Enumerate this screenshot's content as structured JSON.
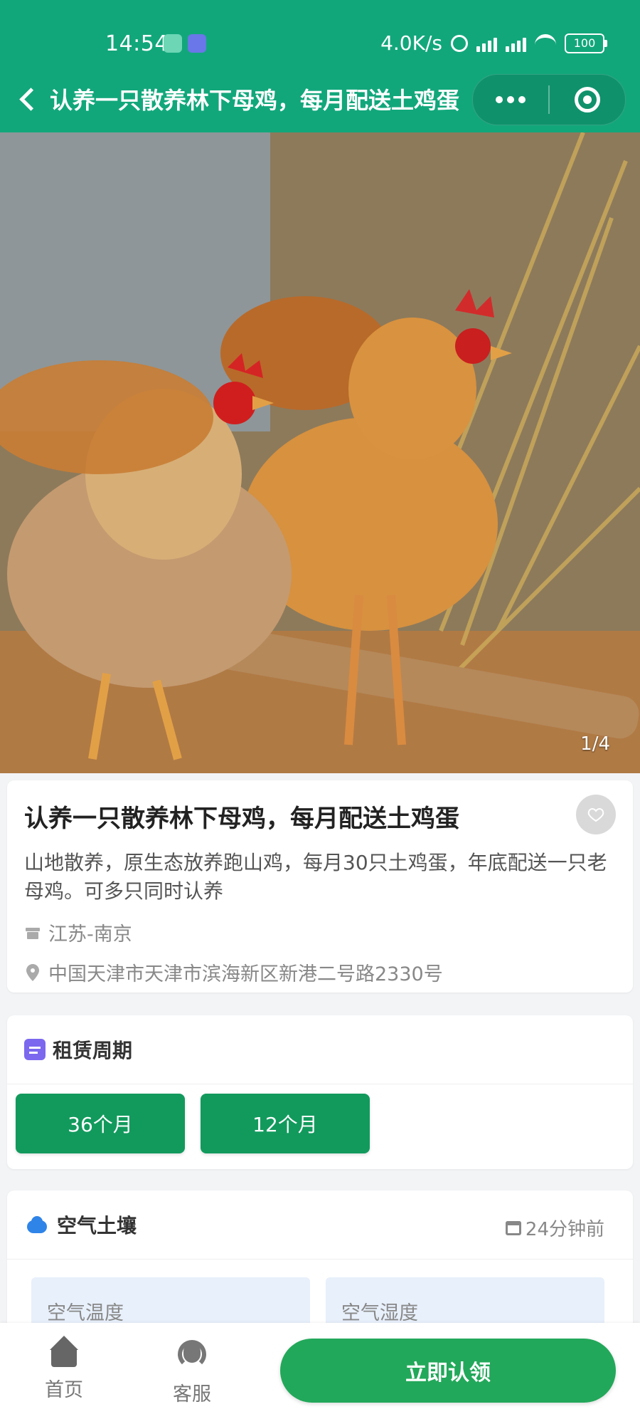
{
  "status_bar": {
    "time": "14:54",
    "network_speed": "4.0K/s",
    "battery": "100"
  },
  "header": {
    "title": "认养一只散养林下母鸡，每月配送土鸡蛋"
  },
  "gallery": {
    "indicator": "1/4"
  },
  "product": {
    "title": "认养一只散养林下母鸡，每月配送土鸡蛋",
    "description": "山地散养，原生态放养跑山鸡，每月30只土鸡蛋，年底配送一只老母鸡。可多只同时认养",
    "shop_location": "江苏-南京",
    "address": "中国天津市天津市滨海新区新港二号路2330号"
  },
  "rental_period": {
    "title": "租赁周期",
    "options": [
      "36个月",
      "12个月"
    ]
  },
  "air_soil": {
    "title": "空气土壤",
    "updated": "24分钟前",
    "metrics": [
      "空气温度",
      "空气湿度"
    ]
  },
  "bottom_nav": {
    "home": "首页",
    "support": "客服",
    "adopt_now": "立即认领"
  },
  "colors": {
    "brand_green": "#12a77b",
    "button_green": "#129a5d",
    "cta_green": "#22a85a"
  }
}
